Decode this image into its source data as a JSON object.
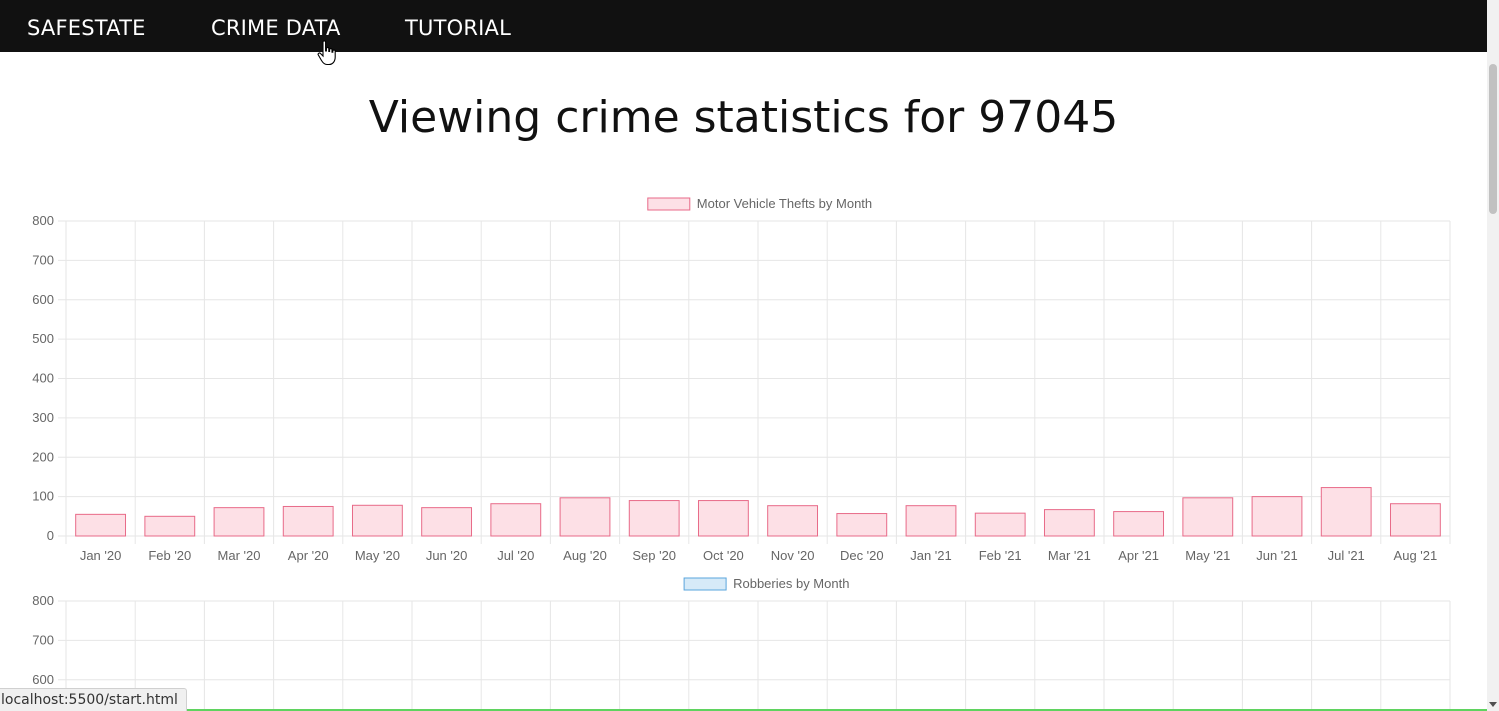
{
  "nav": {
    "brand": "SAFESTATE",
    "items": [
      {
        "label": "CRIME DATA"
      },
      {
        "label": "TUTORIAL"
      }
    ]
  },
  "page": {
    "title": "Viewing crime statistics for 97045"
  },
  "status_bar": {
    "url": "localhost:5500/start.html"
  },
  "colors": {
    "navbar": "#111111",
    "bar1_fill": "#fde0e6",
    "bar1_stroke": "#e86a88",
    "bar2_fill": "#d6eaf8",
    "bar2_stroke": "#5aa5dc"
  },
  "chart_data": [
    {
      "type": "bar",
      "categories": [
        "Jan '20",
        "Feb '20",
        "Mar '20",
        "Apr '20",
        "May '20",
        "Jun '20",
        "Jul '20",
        "Aug '20",
        "Sep '20",
        "Oct '20",
        "Nov '20",
        "Dec '20",
        "Jan '21",
        "Feb '21",
        "Mar '21",
        "Apr '21",
        "May '21",
        "Jun '21",
        "Jul '21",
        "Aug '21"
      ],
      "series": [
        {
          "name": "Motor Vehicle Thefts by Month",
          "values": [
            55,
            50,
            72,
            75,
            78,
            72,
            82,
            97,
            90,
            90,
            77,
            57,
            77,
            58,
            67,
            62,
            97,
            100,
            123,
            82
          ]
        }
      ],
      "yticks": [
        "800",
        "700",
        "600",
        "500",
        "400",
        "300",
        "200",
        "100",
        "0"
      ],
      "ylim": [
        0,
        800
      ],
      "grid": true,
      "legend": "top"
    },
    {
      "type": "bar",
      "categories": [],
      "series": [
        {
          "name": "Robberies by Month",
          "values": []
        }
      ],
      "yticks": [
        "800",
        "700",
        "600"
      ],
      "ylim": [
        0,
        800
      ],
      "grid": true,
      "legend": "top"
    }
  ]
}
